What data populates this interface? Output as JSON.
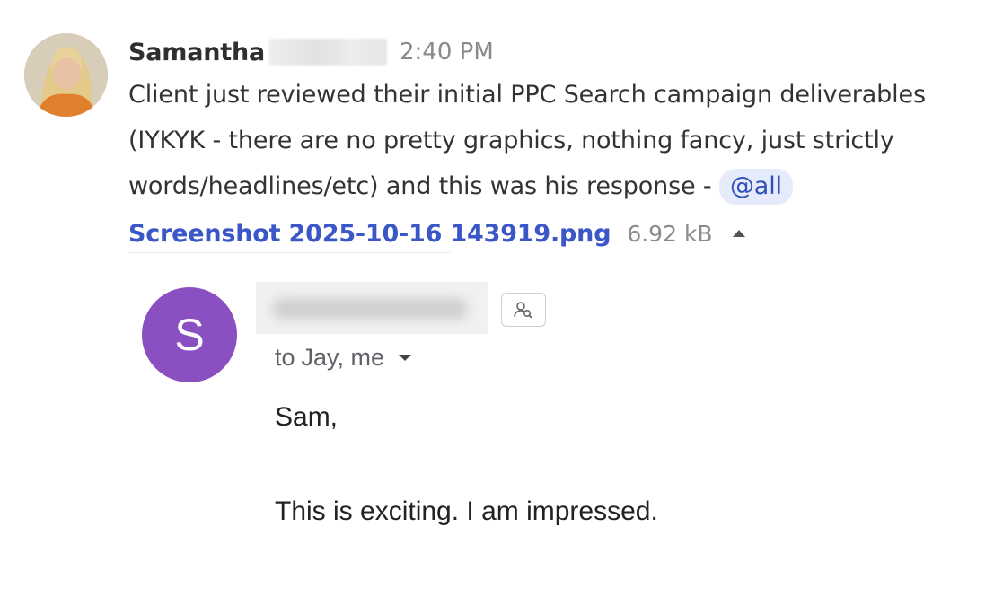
{
  "message": {
    "sender_name": "Samantha",
    "time": "2:40 PM",
    "body_lines": [
      "Client just reviewed their initial PPC Search campaign deliverables",
      "(IYKYK - there are no pretty graphics, nothing fancy, just strictly",
      "words/headlines/etc) and this was his response - "
    ],
    "mention": "@all",
    "attachment": {
      "filename": "Screenshot 2025-10-16 143919.png",
      "size": "6.92 kB",
      "toggle_icon": "caret-up-icon"
    }
  },
  "email": {
    "avatar_letter": "S",
    "avatar_color": "#8a4fc0",
    "contact_icon": "contact-details-icon",
    "recipients_prefix": "to",
    "recipients": "Jay, me",
    "expand_icon": "caret-down-icon",
    "greeting": "Sam,",
    "body": "This is exciting. I am impressed."
  }
}
